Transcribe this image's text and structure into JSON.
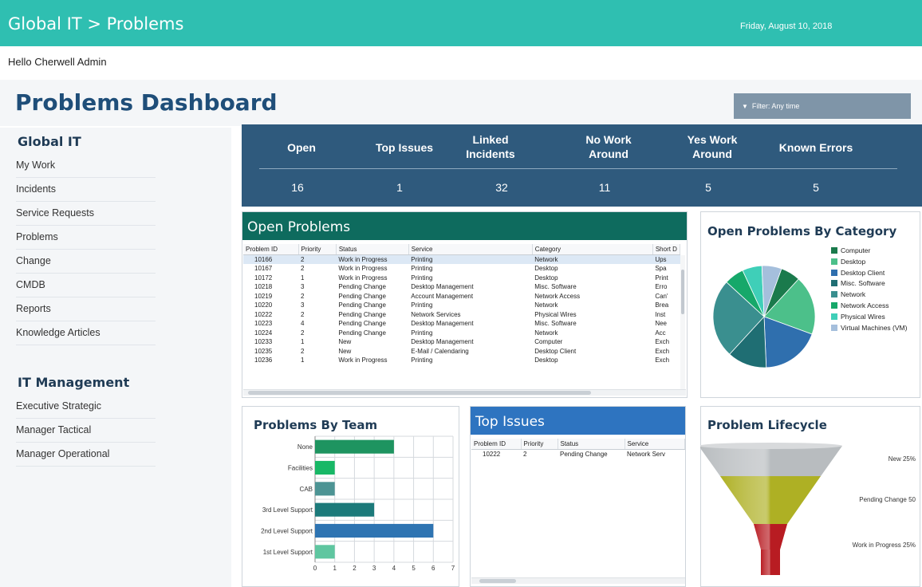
{
  "header": {
    "title": "Global IT > Problems",
    "date": "Friday, August 10, 2018"
  },
  "greeting": "Hello Cherwell Admin",
  "page": {
    "title": "Problems Dashboard",
    "filter_label": "Filter: Any time"
  },
  "sidebar": {
    "sections": [
      {
        "heading": "Global IT",
        "items": [
          "My Work",
          "Incidents",
          "Service Requests",
          "Problems",
          "Change",
          "CMDB",
          "Reports",
          "Knowledge Articles"
        ]
      },
      {
        "heading": "IT Management",
        "items": [
          "Executive Strategic",
          "Manager Tactical",
          "Manager Operational"
        ]
      }
    ]
  },
  "kpis": [
    {
      "label": "Open",
      "value": "16"
    },
    {
      "label": "Top Issues",
      "value": "1"
    },
    {
      "label": "Linked Incidents",
      "value": "32"
    },
    {
      "label": "No Work Around",
      "value": "11"
    },
    {
      "label": "Yes Work Around",
      "value": "5"
    },
    {
      "label": "Known Errors",
      "value": "5"
    }
  ],
  "open_problems": {
    "title": "Open Problems",
    "columns": [
      "Problem ID",
      "Priority",
      "Status",
      "Service",
      "Category",
      "Short D"
    ],
    "rows": [
      [
        "10166",
        "2",
        "Work in Progress",
        "Printing",
        "Network",
        "Ups"
      ],
      [
        "10167",
        "2",
        "Work in Progress",
        "Printing",
        "Desktop",
        "Spa"
      ],
      [
        "10172",
        "1",
        "Work in Progress",
        "Printing",
        "Desktop",
        "Print"
      ],
      [
        "10218",
        "3",
        "Pending Change",
        "Desktop Management",
        "Misc. Software",
        "Erro"
      ],
      [
        "10219",
        "2",
        "Pending Change",
        "Account Management",
        "Network Access",
        "Can'"
      ],
      [
        "10220",
        "3",
        "Pending Change",
        "Printing",
        "Network",
        "Brea"
      ],
      [
        "10222",
        "2",
        "Pending Change",
        "Network Services",
        "Physical Wires",
        "Inst"
      ],
      [
        "10223",
        "4",
        "Pending Change",
        "Desktop Management",
        "Misc. Software",
        "Nee"
      ],
      [
        "10224",
        "2",
        "Pending Change",
        "Printing",
        "Network",
        "Acc"
      ],
      [
        "10233",
        "1",
        "New",
        "Desktop Management",
        "Computer",
        "Exch"
      ],
      [
        "10235",
        "2",
        "New",
        "E-Mail / Calendaring",
        "Desktop Client",
        "Exch"
      ],
      [
        "10236",
        "1",
        "Work in Progress",
        "Printing",
        "Desktop",
        "Exch"
      ]
    ]
  },
  "category_chart": {
    "title": "Open Problems By Category",
    "chart_data": {
      "type": "pie",
      "categories": [
        "Computer",
        "Desktop",
        "Desktop Client",
        "Misc. Software",
        "Network",
        "Network Access",
        "Physical Wires",
        "Virtual Machines (VM)"
      ],
      "values": [
        1,
        3,
        3,
        2,
        4,
        1,
        1,
        1
      ],
      "colors": [
        "#1a7a4c",
        "#4cc08a",
        "#2f6fae",
        "#1f6e73",
        "#3a8f8f",
        "#16a86a",
        "#3fcfb8",
        "#a5bfdc"
      ]
    }
  },
  "team_chart": {
    "title": "Problems By Team",
    "chart_data": {
      "type": "bar",
      "orientation": "horizontal",
      "categories": [
        "None",
        "Facilities",
        "CAB",
        "3rd Level Support",
        "2nd Level Support",
        "1st Level Support"
      ],
      "values": [
        4,
        1,
        1,
        3,
        6,
        1
      ],
      "colors": [
        "#1e9460",
        "#18b866",
        "#4d9494",
        "#1c7a7a",
        "#2e74b2",
        "#5fc6a0"
      ],
      "xlim": [
        0,
        7
      ],
      "xticks": [
        "0",
        "1",
        "2",
        "3",
        "4",
        "5",
        "6",
        "7"
      ],
      "grid": true
    }
  },
  "top_issues": {
    "title": "Top Issues",
    "columns": [
      "Problem ID",
      "Priority",
      "Status",
      "Service"
    ],
    "rows": [
      [
        "10222",
        "2",
        "Pending Change",
        "Network Serv"
      ]
    ]
  },
  "lifecycle_chart": {
    "title": "Problem Lifecycle",
    "chart_data": {
      "type": "funnel",
      "categories": [
        "New",
        "Pending Change",
        "Work in Progress"
      ],
      "labels": [
        "New 25%",
        "Pending Change 50",
        "Work in Progress 25%"
      ],
      "values": [
        25,
        50,
        25
      ],
      "colors": [
        "#b8bcbf",
        "#aeb024",
        "#b81c22"
      ]
    }
  }
}
